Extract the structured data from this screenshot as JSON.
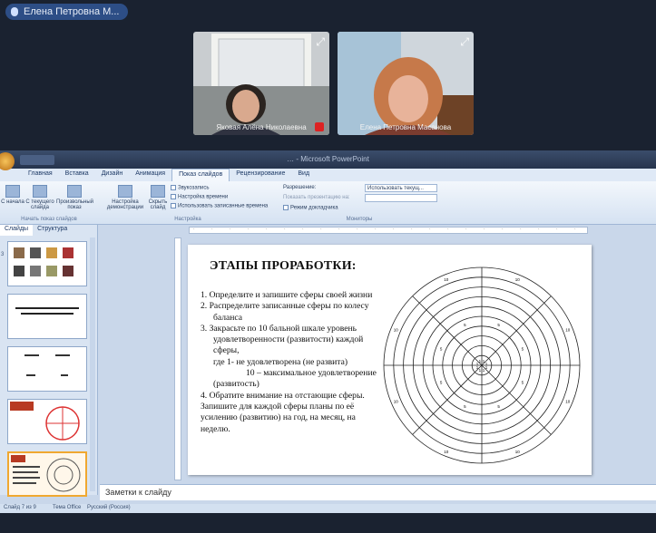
{
  "conference": {
    "presenter_pill": "Елена Петровна М...",
    "participants": [
      {
        "name": "Яковая Алёна Николаевна"
      },
      {
        "name": "Елена Петровна Масанова"
      }
    ]
  },
  "ppt": {
    "window_title": "… - Microsoft PowerPoint",
    "tabs": [
      "Главная",
      "Вставка",
      "Дизайн",
      "Анимация",
      "Показ слайдов",
      "Рецензирование",
      "Вид"
    ],
    "active_tab": "Показ слайдов",
    "ribbon": {
      "btn_from_start": "С начала",
      "btn_from_current": "С текущего слайда",
      "btn_custom": "Произвольный показ",
      "group_start": "Начать показ слайдов",
      "btn_setup": "Настройка демонстрации",
      "btn_hide": "Скрыть слайд",
      "opt_rehearse_narration": "Звукозапись",
      "opt_rehearse_timings": "Настройка времени",
      "opt_use_timings": "Использовать записанные времена",
      "group_setup": "Настройка",
      "resolution_label": "Разрешение:",
      "resolution_value": "Использовать текущ...",
      "show_on_label": "Показать презентацию на:",
      "presenter_view": "Режим докладчика",
      "group_monitors": "Мониторы"
    },
    "pane_tabs": [
      "Слайды",
      "Структура"
    ],
    "slide": {
      "title": "ЭТАПЫ ПРОРАБОТКИ:",
      "lines": [
        "1. Определите и запишите сферы своей жизни",
        "2. Распределите записанные сферы по колесу баланса",
        "3. Закрасьте по 10 бальной шкале уровень удовлетворенности (развитости) каждой сферы,",
        "где 1- не удовлетворена (не развита)",
        "10 – максимальное удовлетворение (развитость)",
        "4. Обратите внимание на отстающие сферы. Запишите для каждой сферы планы по её усилению (развитию) на год, на месяц, на неделю."
      ]
    },
    "notes_placeholder": "Заметки к слайду",
    "status": {
      "slide_counter": "Слайд 7 из 9",
      "theme": "Тема Office",
      "language": "Русский (Россия)"
    }
  },
  "colors": {
    "background": "#1a2230",
    "pill": "#2d4e86",
    "ribbon_tab_text": "#1e3a66",
    "selection": "#f0a830"
  }
}
